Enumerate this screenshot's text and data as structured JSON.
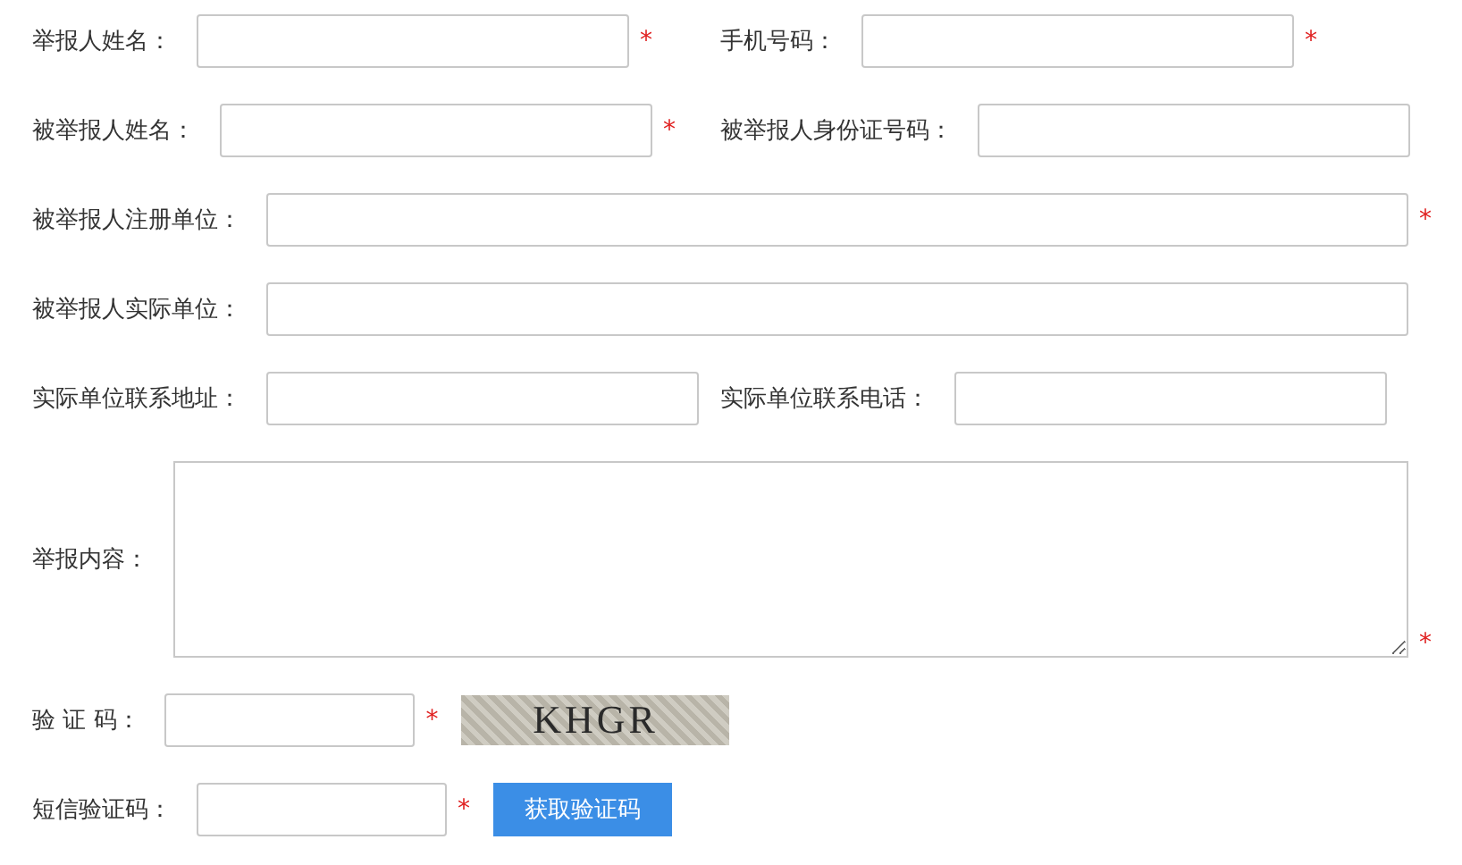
{
  "rows": [
    {
      "fields": [
        {
          "kind": "input",
          "label": "举报人姓名：",
          "mark": "*"
        },
        {
          "kind": "input",
          "label": "手机号码：",
          "mark": "*"
        }
      ]
    },
    {
      "fields": [
        {
          "kind": "input",
          "label": "被举报人姓名：",
          "mark": "*"
        },
        {
          "kind": "input",
          "label": "被举报人身份证号码："
        }
      ]
    },
    {
      "fields": [
        {
          "kind": "input",
          "label": "被举报人注册单位：",
          "mark": "*"
        }
      ]
    },
    {
      "fields": [
        {
          "kind": "input",
          "label": "被举报人实际单位："
        }
      ]
    },
    {
      "fields": [
        {
          "kind": "input",
          "label": "实际单位联系地址："
        },
        {
          "kind": "input",
          "label": "实际单位联系电话："
        }
      ]
    },
    {
      "fields": [
        {
          "kind": "textarea",
          "label": "举报内容：",
          "mark": "*"
        }
      ]
    },
    {
      "fields": [
        {
          "kind": "captcha",
          "label": "验 证 码：",
          "mark": "*",
          "code": "KHGR"
        }
      ]
    },
    {
      "fields": [
        {
          "kind": "sms",
          "label": "短信验证码：",
          "mark": "*",
          "button": "获取验证码"
        }
      ]
    }
  ]
}
